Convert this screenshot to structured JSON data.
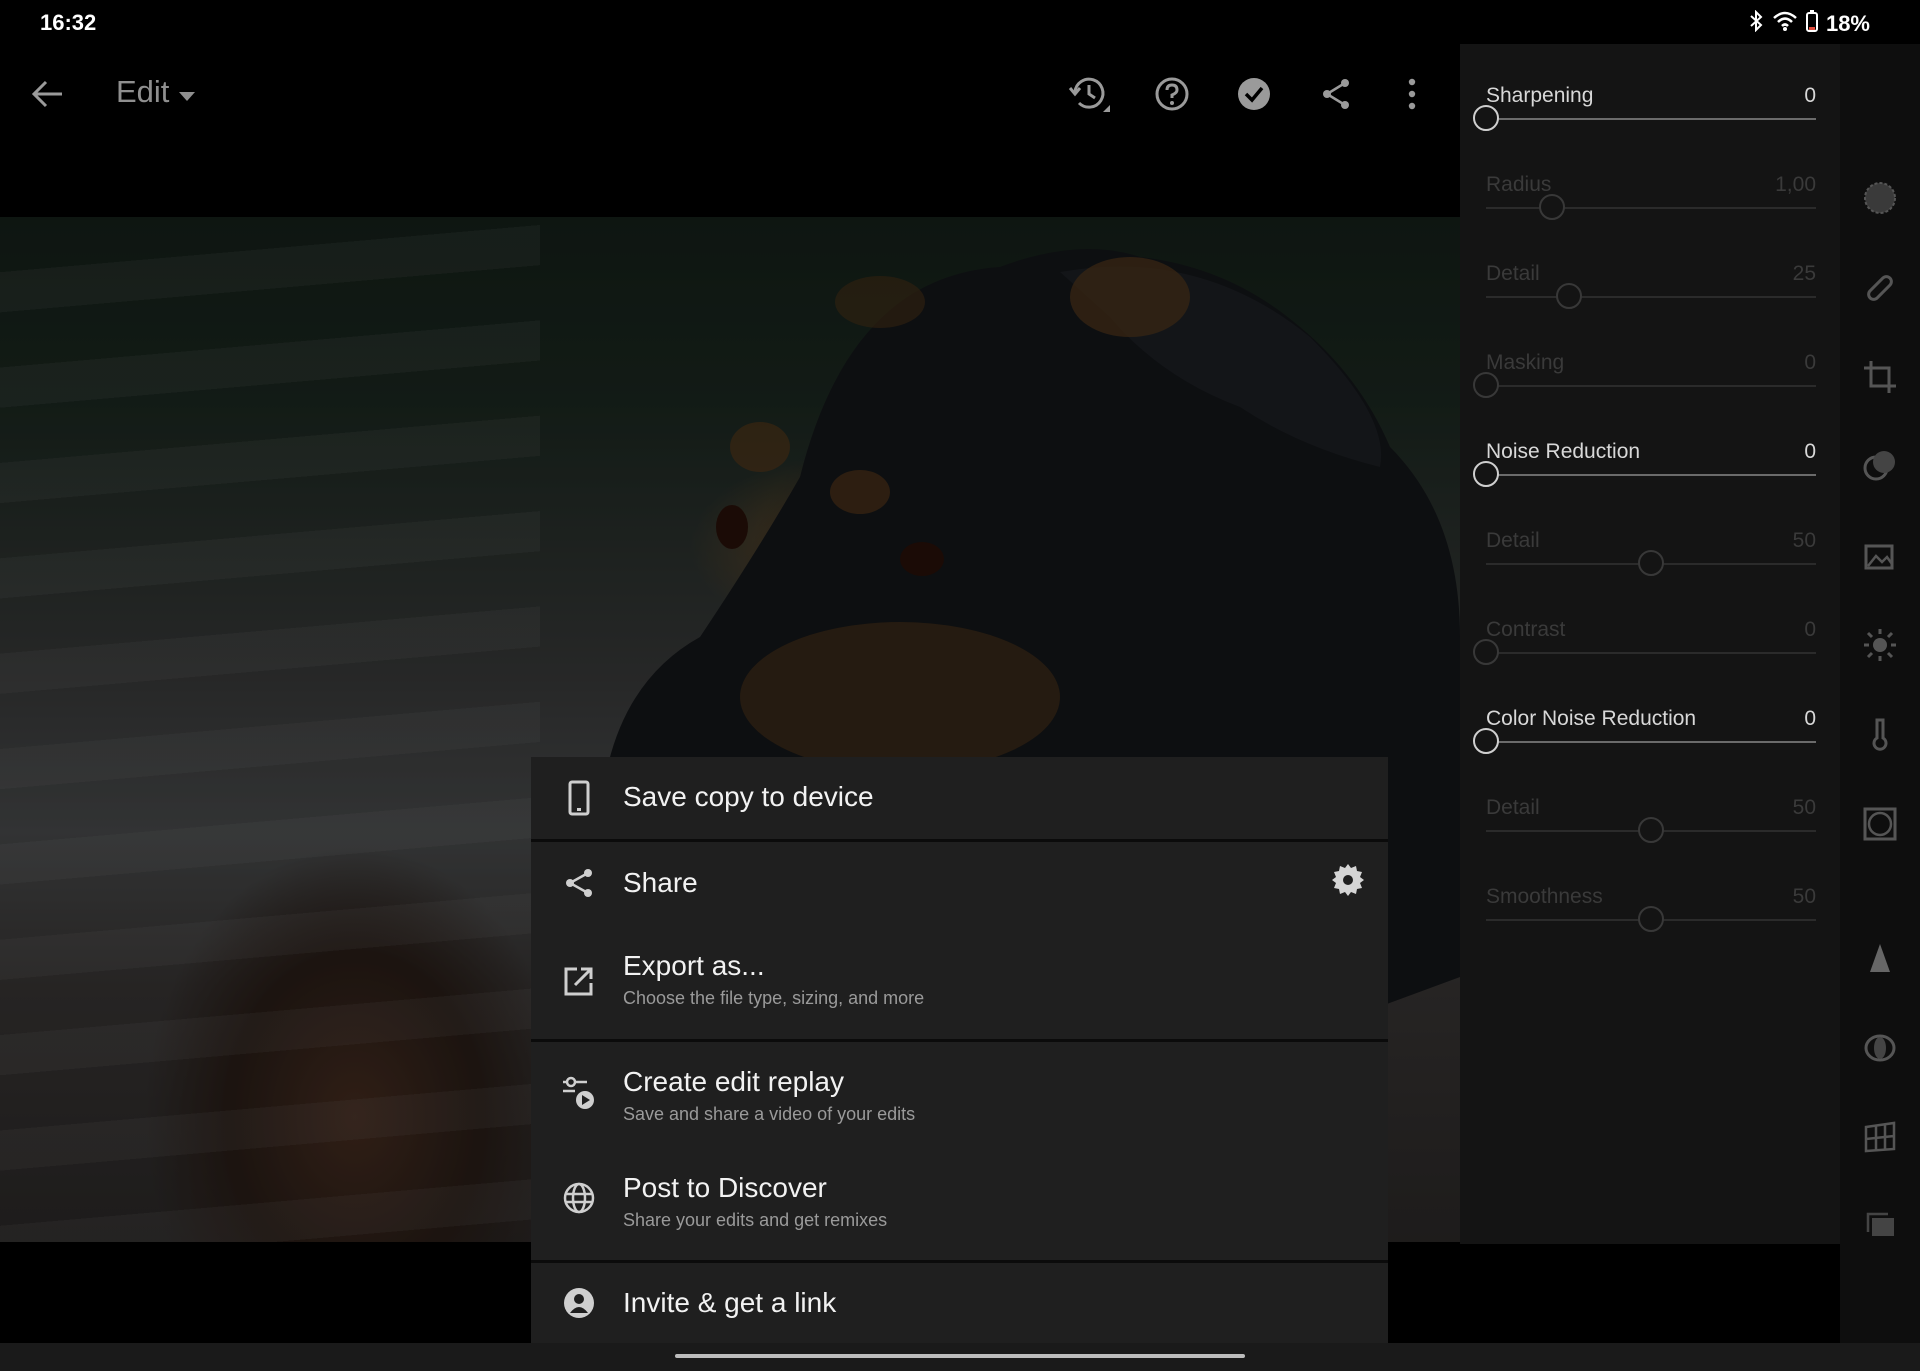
{
  "status_bar": {
    "time": "16:32",
    "battery": "18%"
  },
  "toolbar": {
    "title": "Edit"
  },
  "detail_panel": {
    "sliders": [
      {
        "label": "Sharpening",
        "value": "0",
        "position": 0,
        "active": true
      },
      {
        "label": "Radius",
        "value": "1,00",
        "position": 0.2,
        "active": false
      },
      {
        "label": "Detail",
        "value": "25",
        "position": 0.25,
        "active": false
      },
      {
        "label": "Masking",
        "value": "0",
        "position": 0,
        "active": false
      },
      {
        "label": "Noise Reduction",
        "value": "0",
        "position": 0,
        "active": true
      },
      {
        "label": "Detail",
        "value": "50",
        "position": 0.5,
        "active": false
      },
      {
        "label": "Contrast",
        "value": "0",
        "position": 0,
        "active": false
      },
      {
        "label": "Color Noise Reduction",
        "value": "0",
        "position": 0,
        "active": true
      },
      {
        "label": "Detail",
        "value": "50",
        "position": 0.5,
        "active": false
      },
      {
        "label": "Smoothness",
        "value": "50",
        "position": 0.5,
        "active": false
      }
    ]
  },
  "share_menu": {
    "save_copy": {
      "label": "Save copy to device"
    },
    "share": {
      "label": "Share"
    },
    "export": {
      "label": "Export as...",
      "subtitle": "Choose the file type, sizing, and more"
    },
    "replay": {
      "label": "Create edit replay",
      "subtitle": "Save and share a video of your edits"
    },
    "discover": {
      "label": "Post to Discover",
      "subtitle": "Share your edits and get remixes"
    },
    "invite": {
      "label": "Invite & get a link"
    }
  },
  "icons": {
    "back": "arrow-left-icon",
    "dropdown": "caret-down-icon",
    "history": "history-icon",
    "help": "help-icon",
    "done": "check-circle-icon",
    "share": "share-icon",
    "more": "more-vertical-icon"
  }
}
